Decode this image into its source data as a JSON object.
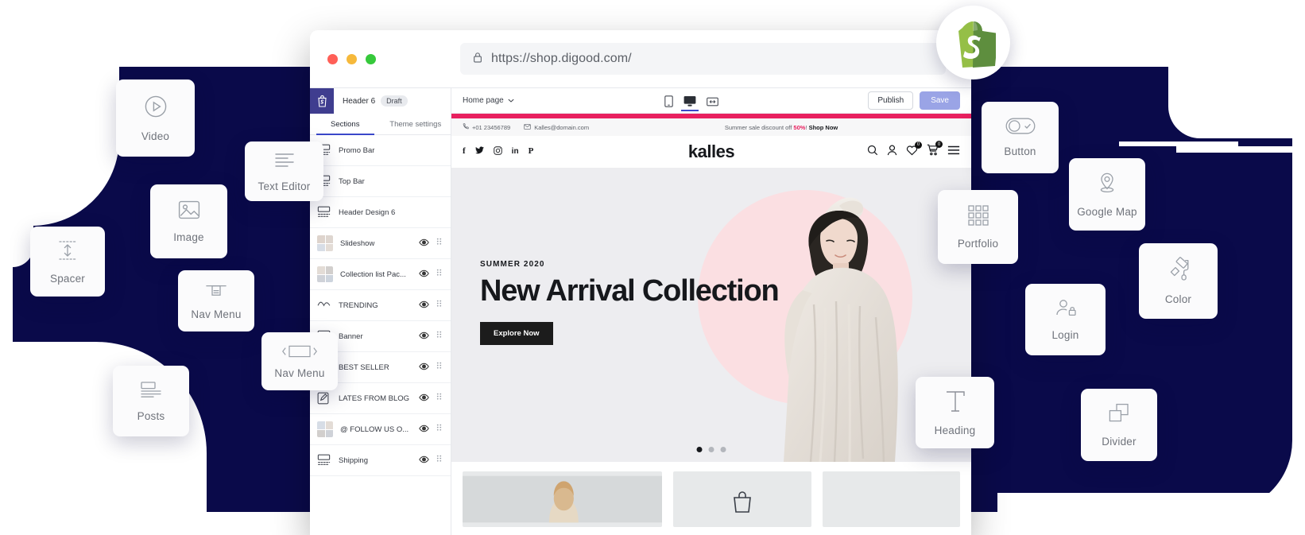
{
  "browser": {
    "url": "https://shop.digood.com/",
    "lock_icon": "lock-icon",
    "traffic_lights": [
      "close-red",
      "minimize-yellow",
      "maximize-green"
    ]
  },
  "editor": {
    "shop_logo": "shopify-logo-icon",
    "section_title": "Header 6",
    "status_chip": "Draft",
    "tabs": [
      {
        "label": "Sections",
        "active": true
      },
      {
        "label": "Theme settings",
        "active": false
      }
    ],
    "sections": [
      {
        "label": "Promo Bar",
        "icon": "layout-icon",
        "eye": false,
        "grip": false
      },
      {
        "label": "Top Bar",
        "icon": "layout-icon",
        "eye": false,
        "grip": false
      },
      {
        "label": "Header Design 6",
        "icon": "layout-icon",
        "eye": false,
        "grip": false
      },
      {
        "label": "Slideshow",
        "icon": "image-thumb",
        "eye": true,
        "grip": true
      },
      {
        "label": "Collection list Pac...",
        "icon": "image-thumb",
        "eye": true,
        "grip": true
      },
      {
        "label": "TRENDING",
        "icon": "wave-icon",
        "eye": true,
        "grip": true
      },
      {
        "label": "Banner",
        "icon": "banner-icon",
        "eye": true,
        "grip": true
      },
      {
        "label": "BEST SELLER",
        "icon": "grid-icon",
        "eye": true,
        "grip": true
      },
      {
        "label": "LATES FROM BLOG",
        "icon": "pencil-icon",
        "eye": true,
        "grip": true
      },
      {
        "label": "@ FOLLOW US O...",
        "icon": "image-thumb",
        "eye": true,
        "grip": true
      },
      {
        "label": "Shipping",
        "icon": "layout-icon",
        "eye": true,
        "grip": true
      }
    ],
    "preview_bar": {
      "page_selector": "Home page",
      "chevron_icon": "chevron-down-icon",
      "devices": [
        {
          "name": "mobile-icon",
          "active": false
        },
        {
          "name": "desktop-icon",
          "active": true
        },
        {
          "name": "fullwidth-icon",
          "active": false
        }
      ],
      "publish_label": "Publish",
      "save_label": "Save"
    }
  },
  "storefront": {
    "topbar": {
      "phone_icon": "phone-icon",
      "phone": "+01 23456789",
      "mail_icon": "mail-icon",
      "email": "Kalles@domain.com",
      "promo_prefix": "Summer sale discount off ",
      "promo_percent": "50%",
      "promo_mid": "! ",
      "promo_cta": "Shop Now"
    },
    "brand": "kalles",
    "socials": [
      "facebook-icon",
      "twitter-icon",
      "instagram-icon",
      "linkedin-icon",
      "pinterest-icon"
    ],
    "header_icons": [
      {
        "name": "search-icon",
        "count": null
      },
      {
        "name": "account-icon",
        "count": null
      },
      {
        "name": "wishlist-icon",
        "count": "0"
      },
      {
        "name": "cart-icon",
        "count": "0"
      },
      {
        "name": "menu-icon",
        "count": null
      }
    ],
    "hero": {
      "kicker": "SUMMER 2020",
      "title": "New Arrival Collection",
      "button": "Explore Now",
      "slides": 3,
      "active_slide": 1
    }
  },
  "widgets": [
    {
      "label": "Video",
      "icon": "play-circle-icon"
    },
    {
      "label": "Text Editor",
      "icon": "text-lines-icon"
    },
    {
      "label": "Image",
      "icon": "image-icon"
    },
    {
      "label": "Spacer",
      "icon": "vertical-arrows-icon"
    },
    {
      "label": "Nav Menu",
      "icon": "nav-menu-icon"
    },
    {
      "label": "Nav Menu",
      "icon": "carousel-icon"
    },
    {
      "label": "Posts",
      "icon": "posts-icon"
    },
    {
      "label": "Button",
      "icon": "toggle-check-icon"
    },
    {
      "label": "Google Map",
      "icon": "map-pin-icon"
    },
    {
      "label": "Portfolio",
      "icon": "grid-dots-icon"
    },
    {
      "label": "Color",
      "icon": "paint-roller-icon"
    },
    {
      "label": "Login",
      "icon": "user-lock-icon"
    },
    {
      "label": "Heading",
      "icon": "typography-t-icon"
    },
    {
      "label": "Divider",
      "icon": "two-squares-icon"
    }
  ],
  "shopify_badge": {
    "icon": "shopify-bag-icon"
  },
  "colors": {
    "navy": "#0a0a4a",
    "accent_pink": "#e8205f",
    "save_purple": "#9aa4e6",
    "tab_blue": "#3a47c9",
    "shopify_green": "#7ab55c"
  }
}
